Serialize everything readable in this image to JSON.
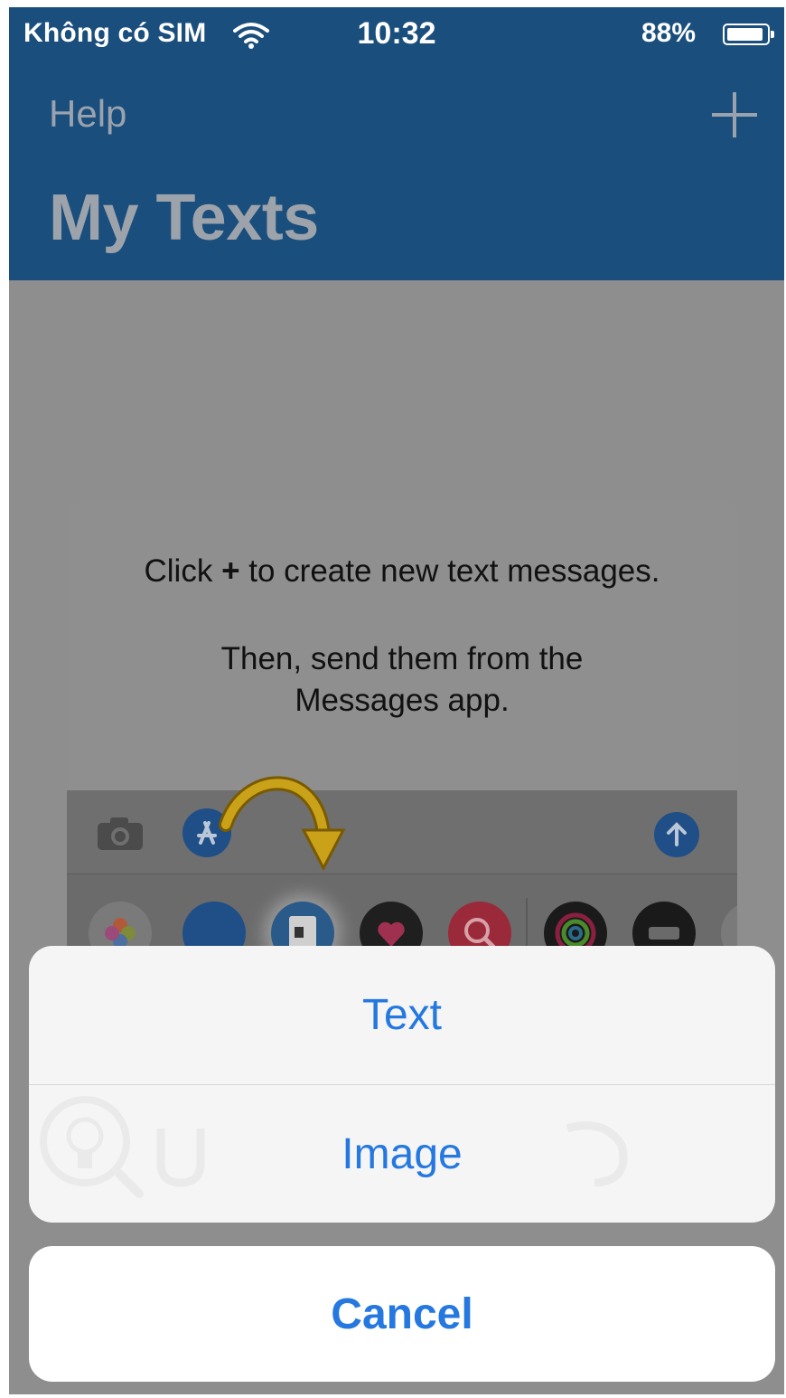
{
  "status_bar": {
    "carrier": "Không có SIM",
    "time": "10:32",
    "battery_percent": "88%"
  },
  "nav": {
    "help_label": "Help",
    "add_icon": "plus-icon",
    "title": "My Texts"
  },
  "help_card": {
    "line1_before": "Click",
    "line1_plus": "+",
    "line1_after": "to create new text messages.",
    "line2": "Then, send them from the",
    "line3": "Messages app."
  },
  "action_sheet": {
    "options": [
      {
        "label": "Text"
      },
      {
        "label": "Image"
      }
    ],
    "cancel_label": "Cancel"
  },
  "colors": {
    "nav_bar": "#1a4e7c",
    "action_blue": "#2478e0",
    "dim_overlay": "#8e8e8e"
  }
}
